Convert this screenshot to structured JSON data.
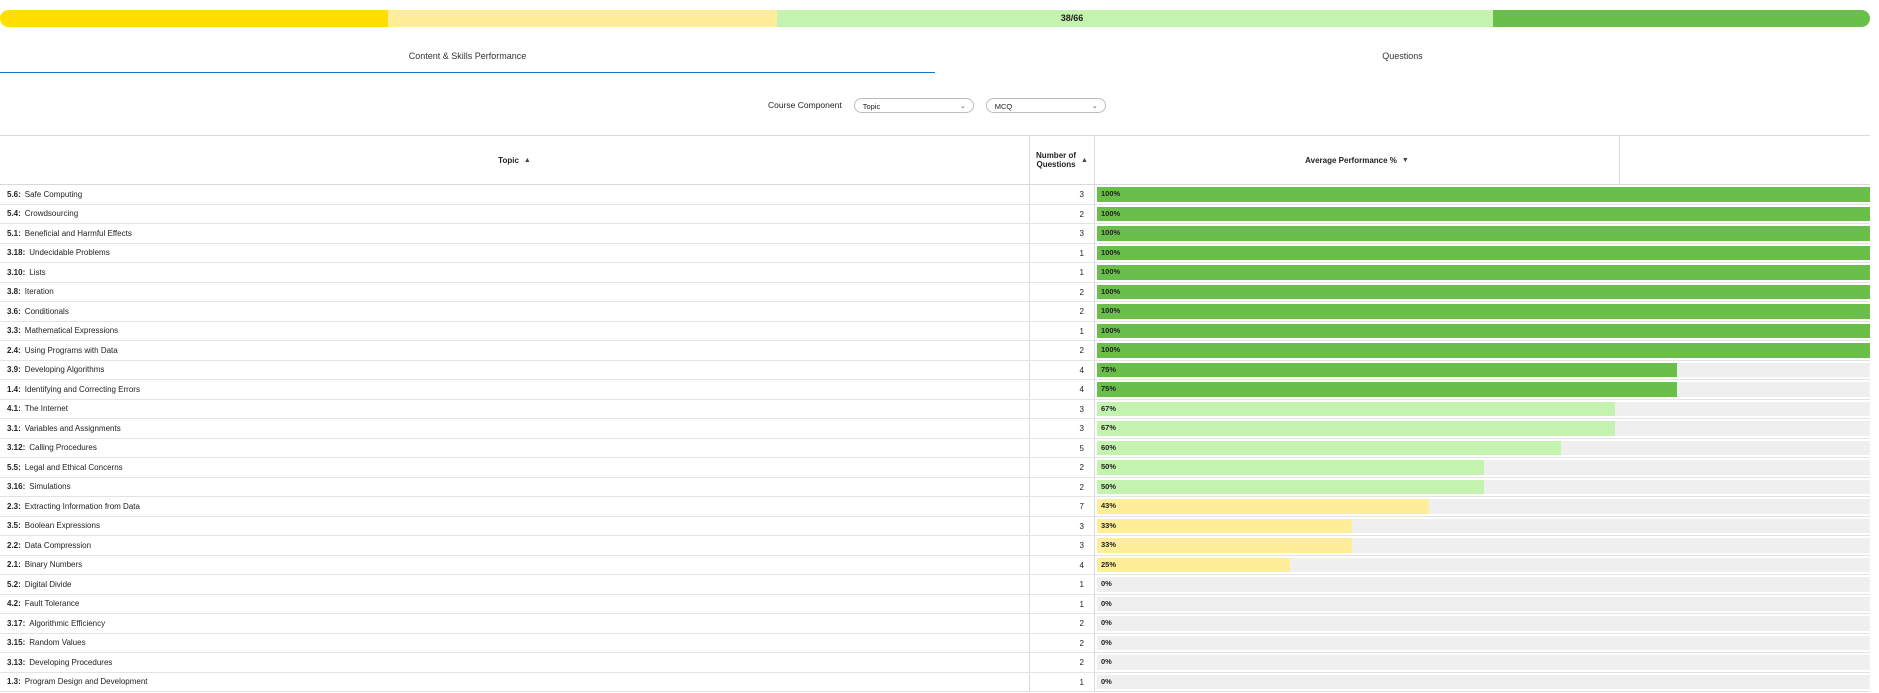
{
  "colors": {
    "dark_green": "#6abf4b",
    "light_green": "#c3f3ae",
    "yellow": "#ffdf00",
    "light_yellow": "#ffed99",
    "track": "#efefef",
    "accent_blue": "#1a73c7"
  },
  "summary": {
    "label": "38/66",
    "segments": [
      {
        "color": "#ffdf00",
        "fraction": 0.2487
      },
      {
        "color": "#ffed99",
        "fraction": 0.2497
      },
      {
        "color": "#c3f3ae",
        "fraction": 0.4599
      },
      {
        "color": "#6abf4b",
        "fraction": 0.2417
      }
    ]
  },
  "tabs": [
    {
      "label": "Content & Skills Performance",
      "active": true
    },
    {
      "label": "Questions",
      "active": false
    }
  ],
  "filters": {
    "label": "Course Component",
    "topic_select": "Topic",
    "type_select": "MCQ"
  },
  "table": {
    "headers": {
      "topic": "Topic",
      "num": "Number of Questions",
      "perf": "Average Performance %"
    },
    "rows": [
      {
        "code": "5.6:",
        "name": "Safe Computing",
        "n": 3,
        "pct": 100,
        "label": "100%"
      },
      {
        "code": "5.4:",
        "name": "Crowdsourcing",
        "n": 2,
        "pct": 100,
        "label": "100%"
      },
      {
        "code": "5.1:",
        "name": "Beneficial and Harmful Effects",
        "n": 3,
        "pct": 100,
        "label": "100%"
      },
      {
        "code": "3.18:",
        "name": "Undecidable Problems",
        "n": 1,
        "pct": 100,
        "label": "100%"
      },
      {
        "code": "3.10:",
        "name": "Lists",
        "n": 1,
        "pct": 100,
        "label": "100%"
      },
      {
        "code": "3.8:",
        "name": "Iteration",
        "n": 2,
        "pct": 100,
        "label": "100%"
      },
      {
        "code": "3.6:",
        "name": "Conditionals",
        "n": 2,
        "pct": 100,
        "label": "100%"
      },
      {
        "code": "3.3:",
        "name": "Mathematical Expressions",
        "n": 1,
        "pct": 100,
        "label": "100%"
      },
      {
        "code": "2.4:",
        "name": "Using Programs with Data",
        "n": 2,
        "pct": 100,
        "label": "100%"
      },
      {
        "code": "3.9:",
        "name": "Developing Algorithms",
        "n": 4,
        "pct": 75,
        "label": "75%"
      },
      {
        "code": "1.4:",
        "name": "Identifying and Correcting Errors",
        "n": 4,
        "pct": 75,
        "label": "75%"
      },
      {
        "code": "4.1:",
        "name": "The Internet",
        "n": 3,
        "pct": 67,
        "label": "67%"
      },
      {
        "code": "3.1:",
        "name": "Variables and Assignments",
        "n": 3,
        "pct": 67,
        "label": "67%"
      },
      {
        "code": "3.12:",
        "name": "Calling Procedures",
        "n": 5,
        "pct": 60,
        "label": "60%"
      },
      {
        "code": "5.5:",
        "name": "Legal and Ethical Concerns",
        "n": 2,
        "pct": 50,
        "label": "50%"
      },
      {
        "code": "3.16:",
        "name": "Simulations",
        "n": 2,
        "pct": 50,
        "label": "50%"
      },
      {
        "code": "2.3:",
        "name": "Extracting Information from Data",
        "n": 7,
        "pct": 43,
        "label": "43%"
      },
      {
        "code": "3.5:",
        "name": "Boolean Expressions",
        "n": 3,
        "pct": 33,
        "label": "33%"
      },
      {
        "code": "2.2:",
        "name": "Data Compression",
        "n": 3,
        "pct": 33,
        "label": "33%"
      },
      {
        "code": "2.1:",
        "name": "Binary Numbers",
        "n": 4,
        "pct": 25,
        "label": "25%"
      },
      {
        "code": "5.2:",
        "name": "Digital Divide",
        "n": 1,
        "pct": 0,
        "label": "0%"
      },
      {
        "code": "4.2:",
        "name": "Fault Tolerance",
        "n": 1,
        "pct": 0,
        "label": "0%"
      },
      {
        "code": "3.17:",
        "name": "Algorithmic Efficiency",
        "n": 2,
        "pct": 0,
        "label": "0%"
      },
      {
        "code": "3.15:",
        "name": "Random Values",
        "n": 2,
        "pct": 0,
        "label": "0%"
      },
      {
        "code": "3.13:",
        "name": "Developing Procedures",
        "n": 2,
        "pct": 0,
        "label": "0%"
      },
      {
        "code": "1.3:",
        "name": "Program Design and Development",
        "n": 1,
        "pct": 0,
        "label": "0%"
      }
    ]
  }
}
